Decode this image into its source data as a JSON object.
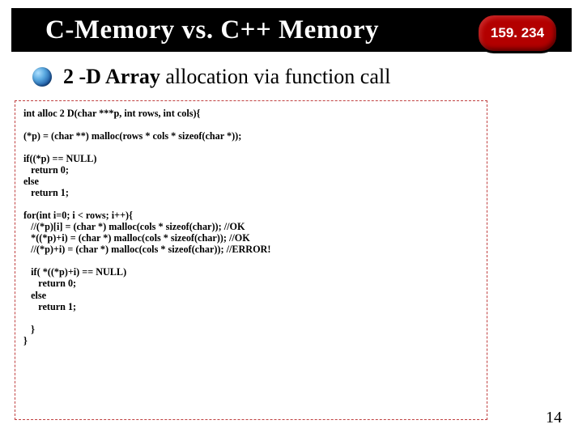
{
  "header": {
    "title": "C-Memory vs. C++ Memory",
    "badge": "159. 234"
  },
  "subtitle": {
    "bold": "2 -D Array",
    "rest": " allocation via function call"
  },
  "code": {
    "line1": "int alloc 2 D(char ***p, int rows, int cols){",
    "block2": "(*p) = (char **) malloc(rows * cols * sizeof(char *));",
    "block3": "if((*p) == NULL)\n   return 0;\nelse\n   return 1;",
    "block4": "for(int i=0; i < rows; i++){\n   //(*p)[i] = (char *) malloc(cols * sizeof(char)); //OK\n   *((*p)+i) = (char *) malloc(cols * sizeof(char)); //OK\n   //(*p)+i) = (char *) malloc(cols * sizeof(char)); //ERROR!",
    "block5": "   if( *((*p)+i) == NULL)\n      return 0;\n   else\n      return 1;",
    "block6": "   }\n}"
  },
  "page_number": "14"
}
